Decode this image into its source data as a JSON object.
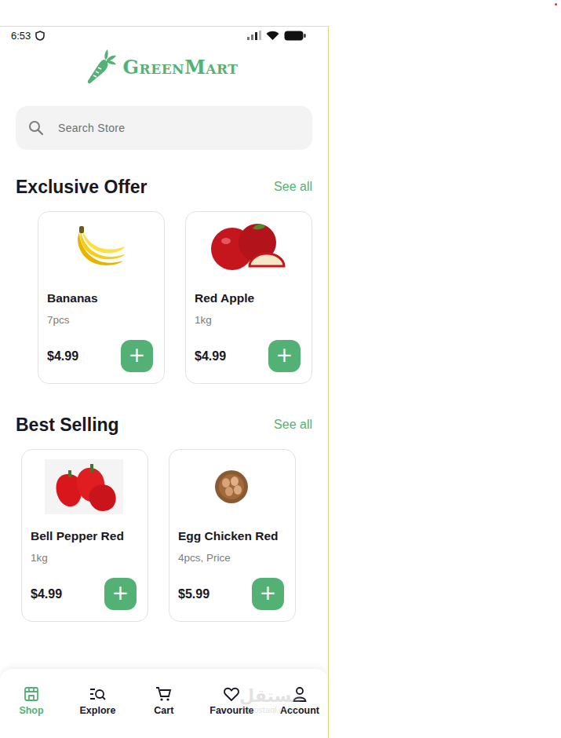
{
  "status_bar": {
    "time": "6:53"
  },
  "logo": {
    "text": "GreenMart"
  },
  "search": {
    "placeholder": "Search Store"
  },
  "sections": [
    {
      "title": "Exclusive Offer",
      "see_all": "See all",
      "products": [
        {
          "name": "Bananas",
          "unit": "7pcs",
          "price": "$4.99",
          "add": "+"
        },
        {
          "name": "Red Apple",
          "unit": "1kg",
          "price": "$4.99",
          "add": "+"
        }
      ]
    },
    {
      "title": "Best Selling",
      "see_all": "See all",
      "products": [
        {
          "name": "Bell Pepper Red",
          "unit": "1kg",
          "price": "$4.99",
          "add": "+"
        },
        {
          "name": "Egg Chicken Red",
          "unit": "4pcs, Price",
          "price": "$5.99",
          "add": "+"
        }
      ]
    }
  ],
  "nav": [
    {
      "label": "Shop",
      "selected": true
    },
    {
      "label": "Explore",
      "selected": false
    },
    {
      "label": "Cart",
      "selected": false
    },
    {
      "label": "Favourite",
      "selected": false
    },
    {
      "label": "Account",
      "selected": false
    }
  ],
  "watermark": {
    "arabic": "مستقل",
    "latin": "mostaql.com"
  }
}
